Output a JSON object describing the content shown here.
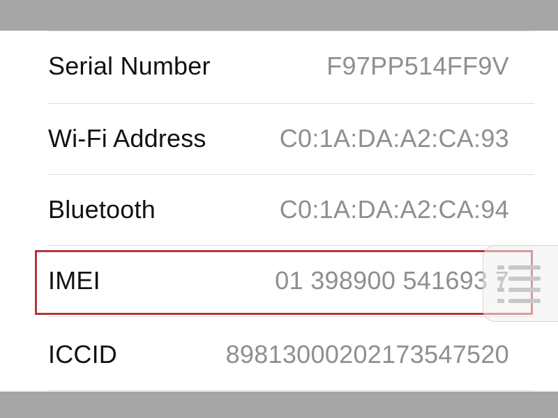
{
  "rows": [
    {
      "label": "Serial Number",
      "value": "F97PP514FF9V"
    },
    {
      "label": "Wi-Fi Address",
      "value": "C0:1A:DA:A2:CA:93"
    },
    {
      "label": "Bluetooth",
      "value": "C0:1A:DA:A2:CA:94"
    },
    {
      "label": "IMEI",
      "value": "01 398900 541693 7"
    },
    {
      "label": "ICCID",
      "value": "89813000202173547520"
    }
  ],
  "highlighted_row": "IMEI",
  "colors": {
    "highlight_border": "#b5343a",
    "label_text": "#111111",
    "value_text": "#8e8e93",
    "background": "#ffffff",
    "frame": "#a6a6a6"
  },
  "icons": {
    "floating_button": "list-icon"
  }
}
